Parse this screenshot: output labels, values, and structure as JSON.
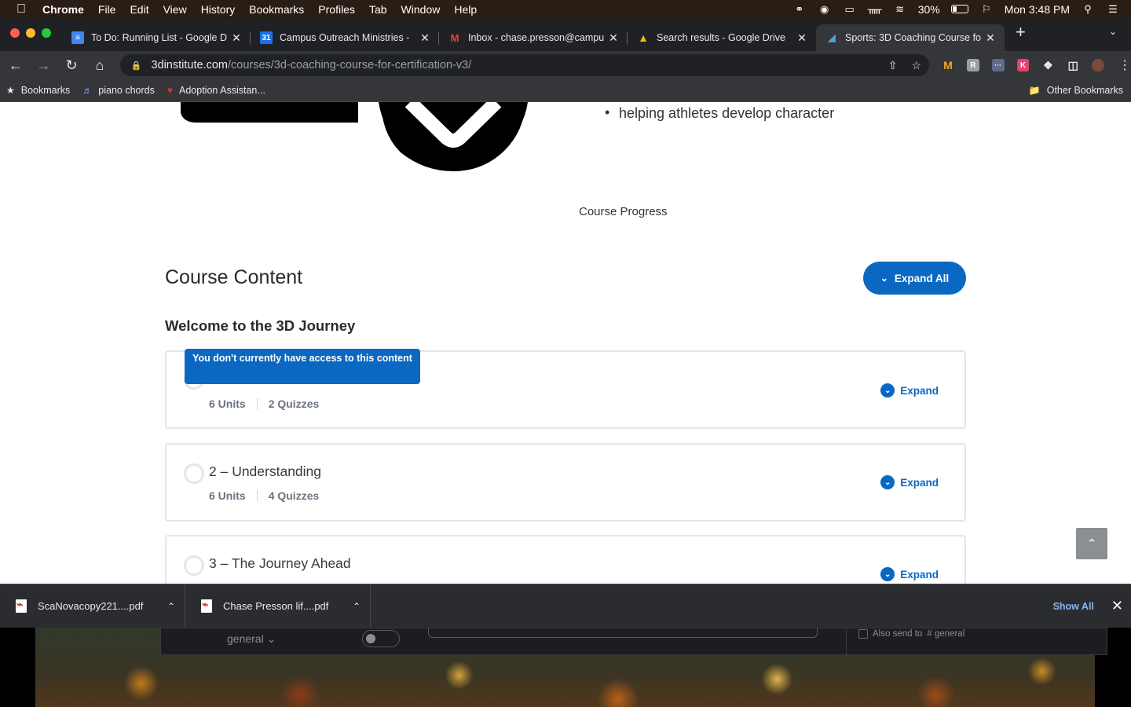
{
  "menubar": {
    "app": "Chrome",
    "items": [
      "File",
      "Edit",
      "View",
      "History",
      "Bookmarks",
      "Profiles",
      "Tab",
      "Window",
      "Help"
    ],
    "battery": "30%",
    "battery_level": 0.3,
    "clock": "Mon 3:48 PM"
  },
  "tabs": [
    {
      "title": "To Do: Running List - Google D",
      "icon": "google-docs-icon",
      "color": "#4285f4"
    },
    {
      "title": "Campus Outreach Ministries - ",
      "icon": "google-calendar-icon",
      "color": "#1a73e8"
    },
    {
      "title": "Inbox - chase.presson@campu",
      "icon": "gmail-icon",
      "color": "#ea4335"
    },
    {
      "title": "Search results - Google Drive",
      "icon": "google-drive-icon",
      "color": "#fbbc04"
    },
    {
      "title": "Sports: 3D Coaching Course fo",
      "icon": "3d-institute-icon",
      "color": "#4fa3e0"
    }
  ],
  "omnibox": {
    "host": "3dinstitute.com",
    "path": "/courses/3d-coaching-course-for-certification-v3/"
  },
  "bookmarks": {
    "items": [
      "Bookmarks",
      "piano chords",
      "Adoption Assistan..."
    ],
    "other": "Other Bookmarks"
  },
  "page": {
    "bullet": "helping athletes develop character",
    "course_progress": "Course Progress",
    "content_title": "Course Content",
    "expand_all": "Expand All",
    "section_heading": "Welcome to the 3D Journey",
    "tooltip": "You don't currently have access to this content",
    "lessons": [
      {
        "title": "",
        "units": "6 Units",
        "quizzes": "2 Quizzes",
        "expand": "Expand"
      },
      {
        "title": "2 – Understanding",
        "units": "6 Units",
        "quizzes": "4 Quizzes",
        "expand": "Expand"
      },
      {
        "title": "3 – The Journey Ahead",
        "units": "",
        "quizzes": "",
        "expand": "Expand"
      }
    ]
  },
  "downloads": {
    "files": [
      "ScaNovacopy221....pdf",
      "Chase Presson lif....pdf"
    ],
    "show_all": "Show All"
  },
  "desktop": {
    "channel": "general",
    "also_send": "Also send to",
    "also_channel": "# general"
  },
  "colors": {
    "accent": "#0b68c2",
    "menubar": "#2a1d14",
    "chrome_dark": "#35363a"
  }
}
